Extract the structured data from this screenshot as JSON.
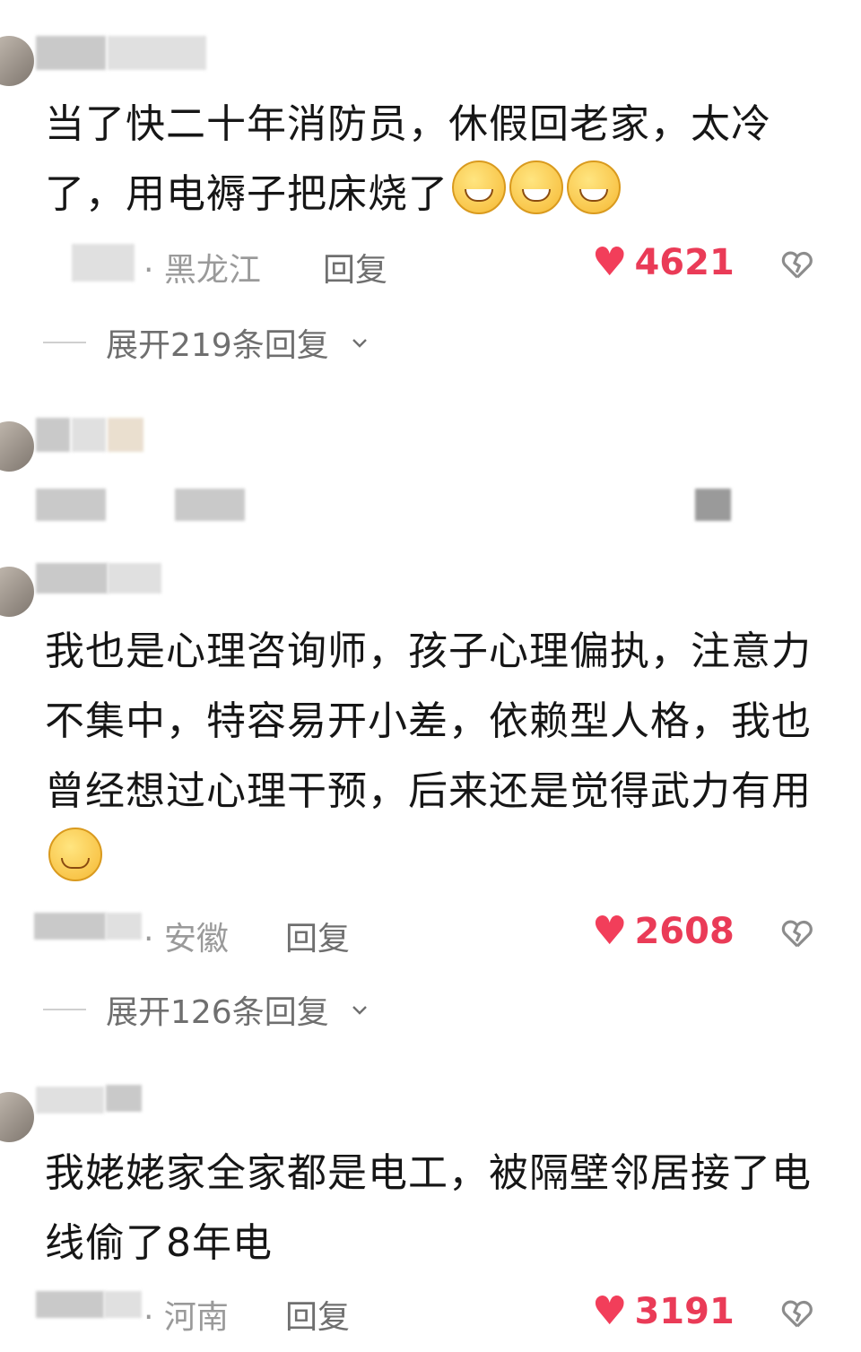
{
  "comments": [
    {
      "text": "当了快二十年消防员，休假回老家，太冷了，用电褥子把床烧了",
      "emoji": [
        "grin-sweat-emoji",
        "grin-sweat-emoji",
        "grin-sweat-emoji"
      ],
      "location": "· 黑龙江",
      "reply_label": "回复",
      "likes": "4621",
      "expand_label": "展开219条回复"
    },
    {
      "text": "我也是心理咨询师，孩子心理偏执，注意力不集中，特容易开小差，依赖型人格，我也曾经想过心理干预，后来还是觉得武力有用",
      "emoji": [
        "smile-emoji"
      ],
      "location": "· 安徽",
      "reply_label": "回复",
      "likes": "2608",
      "expand_label": "展开126条回复"
    },
    {
      "text": "我姥姥家全家都是电工，被隔壁邻居接了电线偷了8年电",
      "location": "· 河南",
      "reply_label": "回复",
      "likes": "3191"
    }
  ],
  "icons": {
    "like": "heart-icon",
    "dislike": "broken-heart-icon",
    "expand": "chevron-down-icon"
  },
  "colors": {
    "like": "#f23e5a",
    "text": "#161616",
    "meta": "#9a9a9a"
  }
}
